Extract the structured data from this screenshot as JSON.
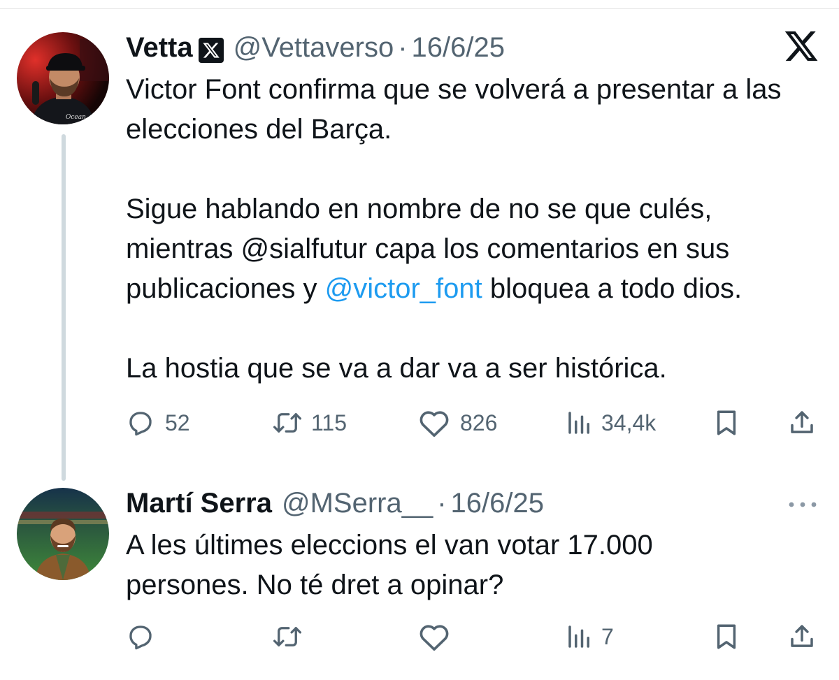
{
  "tweet1": {
    "author": {
      "name": "Vetta",
      "handle": "@Vettaverso",
      "date": "16/6/25"
    },
    "text": {
      "p1": "Victor Font confirma que se volverá a presentar a las elecciones del Barça.",
      "p2a": "Sigue hablando en nombre de no se que culés, mientras @sialfutur capa los comentarios en sus publicaciones y ",
      "p2_mention": "@victor_font",
      "p2b": " bloquea a todo dios.",
      "p3": "La hostia que se va a dar va a ser histórica."
    },
    "stats": {
      "replies": "52",
      "reposts": "115",
      "likes": "826",
      "views": "34,4k"
    }
  },
  "tweet2": {
    "author": {
      "name": "Martí Serra",
      "handle": "@MSerra__",
      "date": "16/6/25"
    },
    "text": {
      "p1": "A les últimes eleccions el van votar 17.000 persones. No té dret a opinar?"
    },
    "stats": {
      "views": "7"
    }
  },
  "separator": "·",
  "icons": {
    "app_logo": "x-logo-icon",
    "verified": "x-badge-icon",
    "more": "more-options-icon",
    "reply": "reply-icon",
    "repost": "repost-icon",
    "like": "like-icon",
    "views": "views-icon",
    "bookmark": "bookmark-icon",
    "share": "share-icon"
  },
  "colors": {
    "text": "#0f1419",
    "secondary": "#536471",
    "link": "#1d9bf0",
    "thread_line": "#cfd9de"
  }
}
